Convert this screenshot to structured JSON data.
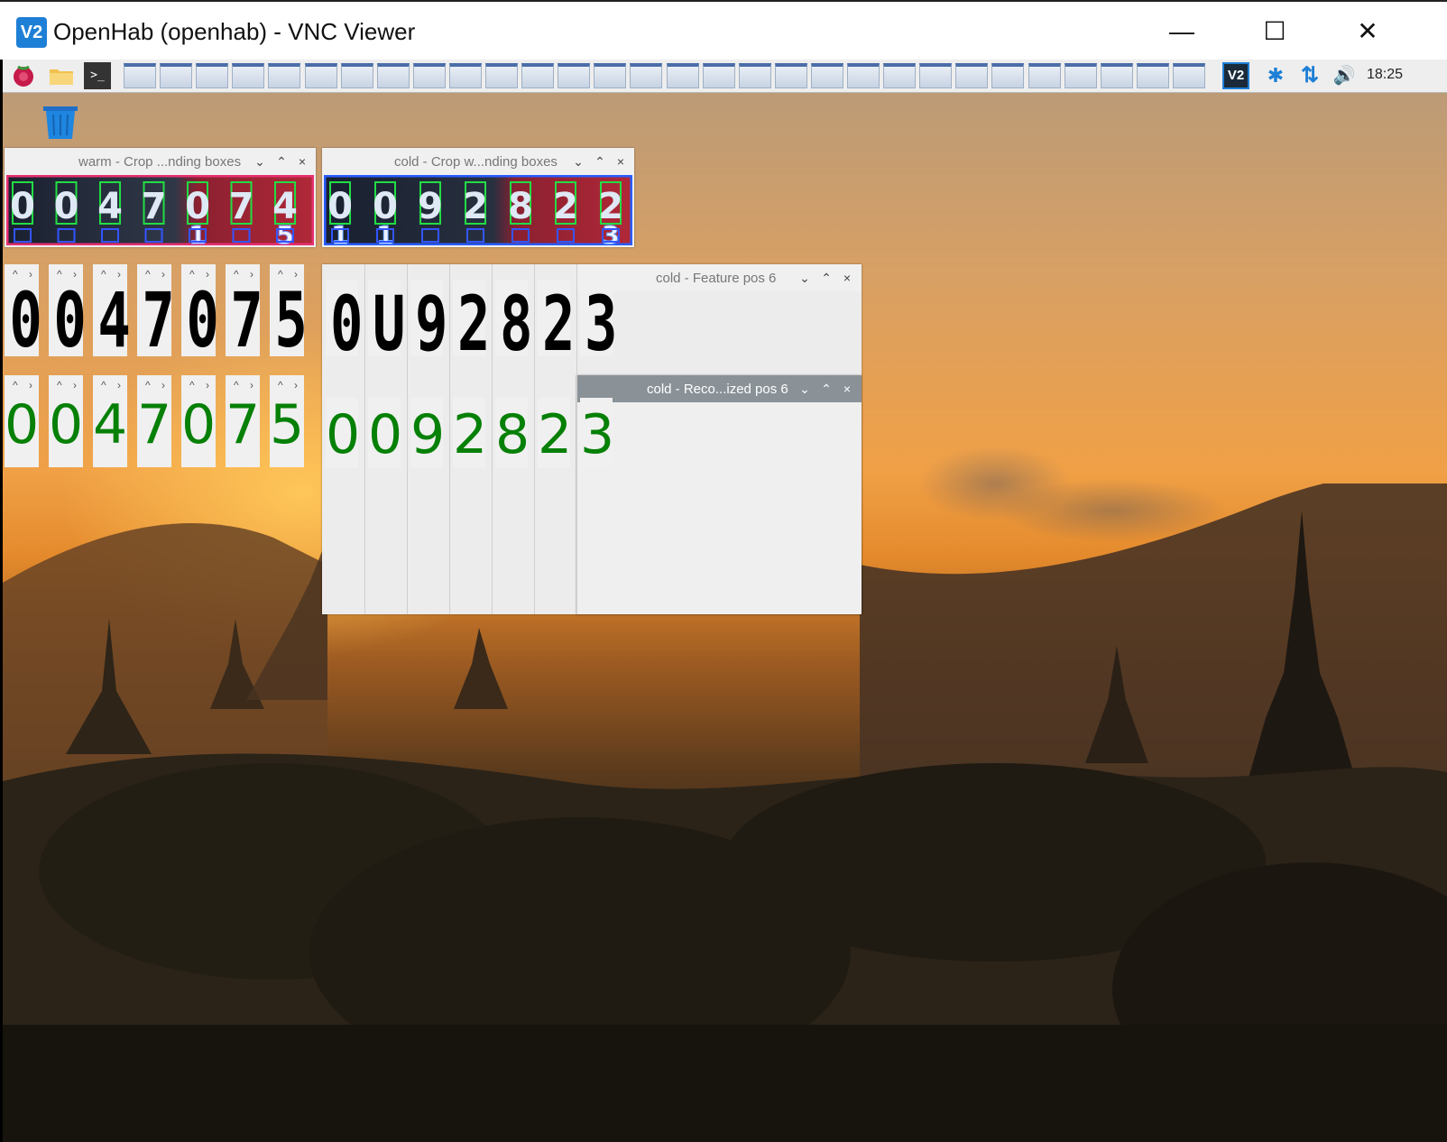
{
  "window": {
    "title": "OpenHab (openhab) - VNC Viewer",
    "logo_text": "V2",
    "minimize_glyph": "—",
    "maximize_glyph": "☐",
    "close_glyph": "✕"
  },
  "taskbar": {
    "clock": "18:25",
    "terminal_glyph": ">_",
    "vnc_glyph": "V2",
    "bluetooth_glyph": "✱",
    "network_glyph": "⇅",
    "volume_glyph": "🔊",
    "task_count": 30
  },
  "windows": {
    "warm_crop": {
      "title": "warm - Crop ...nding boxes"
    },
    "cold_crop": {
      "title": "cold - Crop w...nding boxes"
    },
    "cold_feature": {
      "title": "cold - Feature pos 6"
    },
    "cold_recognized": {
      "title": "cold - Reco...ized pos 6"
    },
    "btn_down": "⌄",
    "btn_up": "⌃",
    "btn_close": "×",
    "cell_btn_up": "^",
    "cell_btn_right": "›"
  },
  "digits": {
    "warm_feature": [
      "0",
      "0",
      "4",
      "7",
      "0",
      "7",
      "5"
    ],
    "warm_recognized": [
      "0",
      "0",
      "4",
      "7",
      "0",
      "7",
      "5"
    ],
    "cold_feature": [
      "0",
      "U",
      "9",
      "2",
      "8",
      "2",
      "3"
    ],
    "cold_recognized": [
      "0",
      "0",
      "9",
      "2",
      "8",
      "2",
      "3"
    ],
    "warm_crop_main": [
      "0",
      "0",
      "4",
      "7",
      "0",
      "7",
      "4"
    ],
    "warm_crop_second": [
      "",
      "",
      "",
      "",
      "1",
      "",
      "5"
    ],
    "cold_crop_main": [
      "0",
      "0",
      "9",
      "2",
      "8",
      "2",
      "2"
    ],
    "cold_crop_second": [
      "1",
      "1",
      "",
      "",
      "",
      "",
      "3"
    ]
  },
  "colors": {
    "green_digit": "#068006",
    "box_green": "#22dd44",
    "box_blue": "#3355ff",
    "accent_blue": "#1e7fd6"
  }
}
